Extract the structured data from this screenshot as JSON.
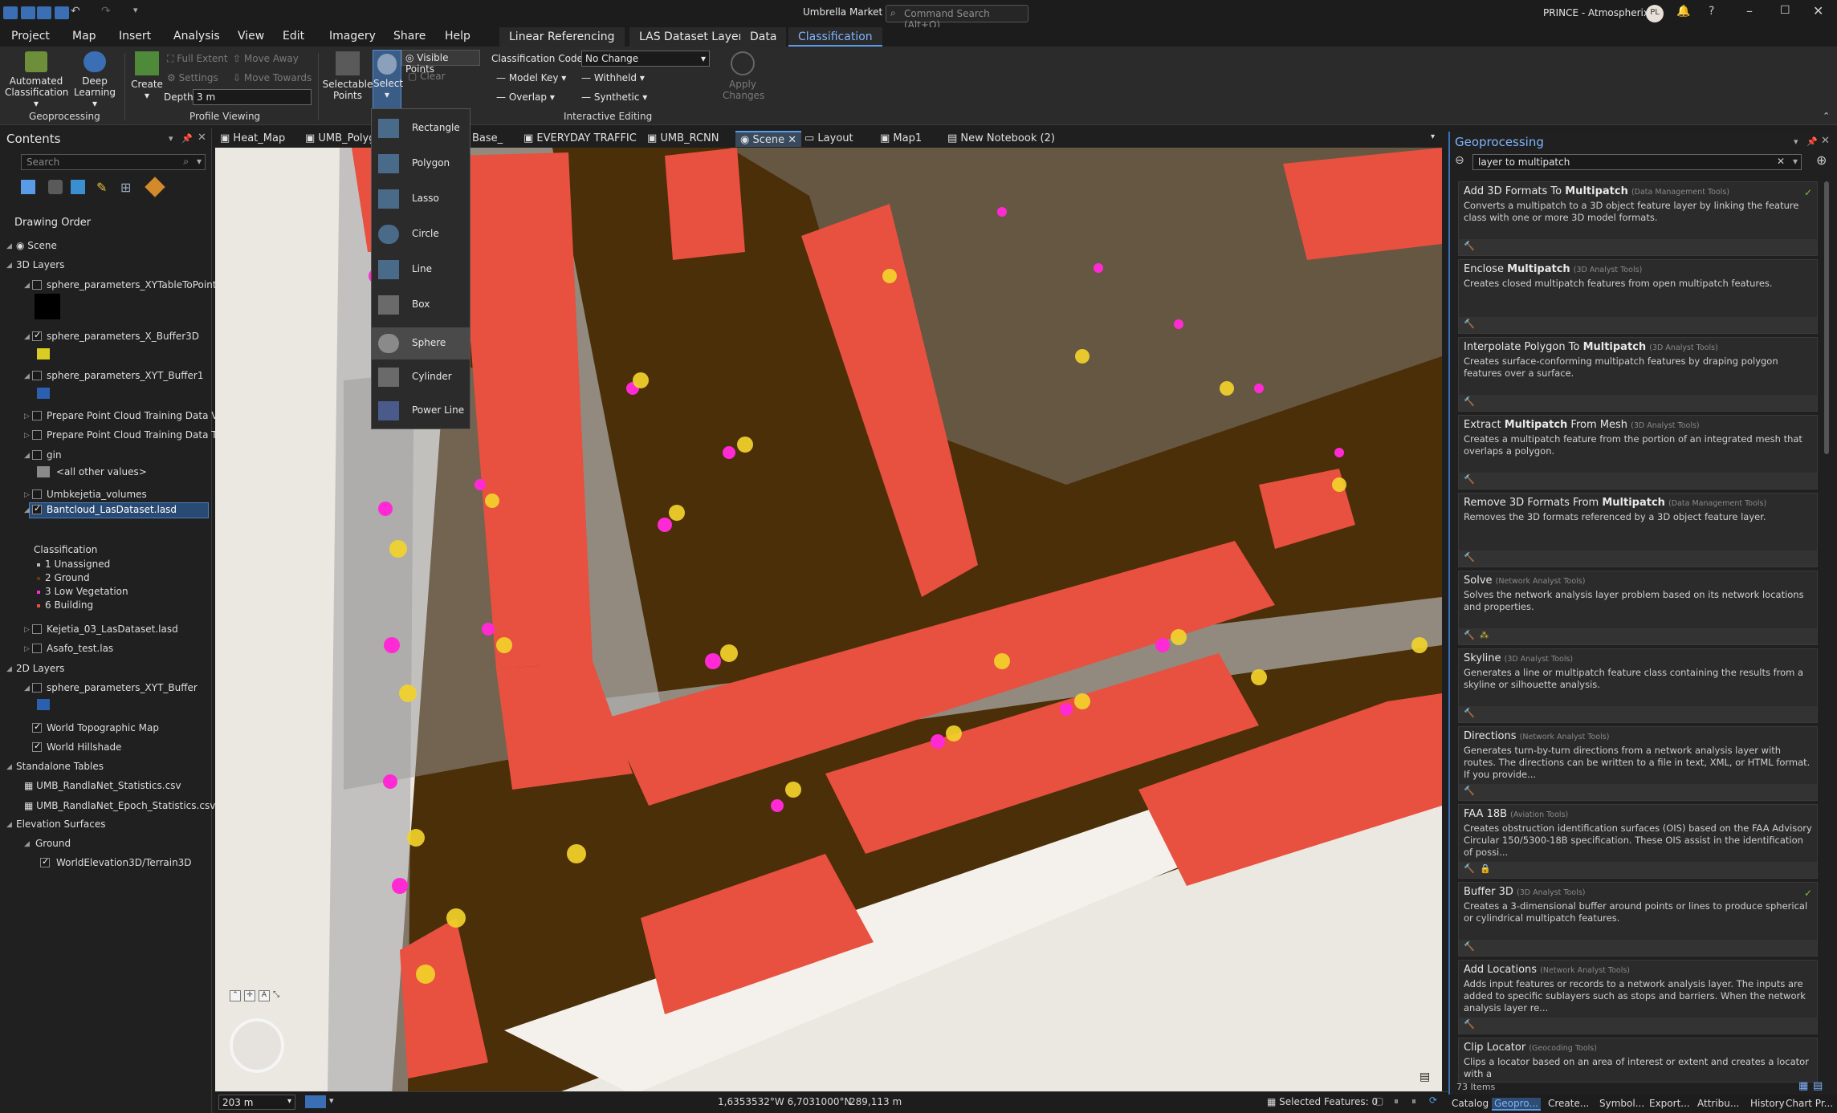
{
  "title_bar": {
    "project_name": "Umbrella Market",
    "search_placeholder": "Command Search (Alt+Q)",
    "user": "PRINCE - Atmospherix",
    "user_initials": "PL"
  },
  "ribbon_tabs": [
    "Project",
    "Map",
    "Insert",
    "Analysis",
    "View",
    "Edit",
    "Imagery",
    "Share",
    "Help"
  ],
  "context_tabs": [
    "Linear Referencing",
    "LAS Dataset Layer",
    "Data",
    "Classification"
  ],
  "ribbon": {
    "automated_classification": "Automated Classification",
    "deep_learning": "Deep Learning",
    "group_geoprocessing": "Geoprocessing",
    "create": "Create",
    "full_extent": "Full Extent",
    "move_away": "Move Away",
    "settings": "Settings",
    "move_towards": "Move Towards",
    "depth_label": "Depth",
    "depth_value": "3 m",
    "group_profile_viewing": "Profile Viewing",
    "selectable_points": "Selectable Points",
    "select": "Select",
    "visible_points": "Visible Points",
    "clear": "Clear",
    "classification_code_label": "Classification Code",
    "classification_code_value": "No Change",
    "model_key": "Model Key",
    "withheld": "Withheld",
    "overlap": "Overlap",
    "synthetic": "Synthetic",
    "apply_changes": "Apply Changes",
    "group_interactive_editing": "Interactive Editing"
  },
  "select_menu": [
    "Rectangle",
    "Polygon",
    "Lasso",
    "Circle",
    "Line",
    "Box",
    "Sphere",
    "Cylinder",
    "Power Line"
  ],
  "view_tabs": [
    "Heat_Map",
    "UMB_Polyg",
    "Base_",
    "EVERYDAY TRAFFIC",
    "UMB_RCNN",
    "Scene",
    "Layout",
    "Map1",
    "New Notebook (2)"
  ],
  "contents": {
    "title": "Contents",
    "search_placeholder": "Search",
    "drawing_order": "Drawing Order",
    "scene": "Scene",
    "layers_3d": "3D Layers",
    "l1": "sphere_parameters_XYTableToPoint",
    "l2": "sphere_parameters_X_Buffer3D",
    "l3": "sphere_parameters_XYT_Buffer1",
    "l4": "Prepare Point Cloud Training Data V...",
    "l5": "Prepare Point Cloud Training Data T...",
    "l6": "gin",
    "l6_sub": "<all other values>",
    "l7": "Umbkejetia_volumes",
    "l8": "Bantcloud_LasDataset.lasd",
    "classification": "Classification",
    "classes": [
      "1  Unassigned",
      "2  Ground",
      "3  Low Vegetation",
      "6  Building"
    ],
    "l9": "Kejetia_03_LasDataset.lasd",
    "l10": "Asafo_test.las",
    "layers_2d": "2D Layers",
    "l11": "sphere_parameters_XYT_Buffer",
    "l12": "World Topographic Map",
    "l13": "World Hillshade",
    "standalone": "Standalone Tables",
    "t1": "UMB_RandlaNet_Statistics.csv",
    "t2": "UMB_RandlaNet_Epoch_Statistics.csv",
    "elevation": "Elevation Surfaces",
    "ground": "Ground",
    "terrain": "WorldElevation3D/Terrain3D"
  },
  "geoprocessing": {
    "title": "Geoprocessing",
    "search_value": "layer to multipatch",
    "items_count": "73 Items",
    "results": [
      {
        "pre": "Add 3D Formats To ",
        "bold": "Multipatch",
        "toolbox": "(Data Management Tools)",
        "desc": "Converts a multipatch to a 3D object feature layer by linking the feature class with one or more 3D model formats."
      },
      {
        "pre": "Enclose ",
        "bold": "Multipatch",
        "toolbox": "(3D Analyst Tools)",
        "desc": "Creates  closed multipatch features from open multipatch features."
      },
      {
        "pre": "Interpolate Polygon To ",
        "bold": "Multipatch",
        "toolbox": "(3D Analyst Tools)",
        "desc": "Creates surface-conforming  multipatch features by draping polygon features over a surface."
      },
      {
        "pre": "Extract ",
        "bold": "Multipatch",
        "post": " From Mesh",
        "toolbox": "(3D Analyst Tools)",
        "desc": "Creates a multipatch feature from the portion of an integrated mesh that overlaps a polygon."
      },
      {
        "pre": "Remove 3D Formats From ",
        "bold": "Multipatch",
        "toolbox": "(Data Management Tools)",
        "desc": "Removes the 3D formats  referenced by a 3D object feature layer."
      },
      {
        "pre": "Solve",
        "toolbox": "(Network Analyst Tools)",
        "desc": "Solves the network analysis layer problem based on its network locations and properties."
      },
      {
        "pre": "Skyline",
        "toolbox": "(3D Analyst Tools)",
        "desc": "Generates a line or multipatch feature class containing the results from a skyline or silhouette analysis."
      },
      {
        "pre": "Directions",
        "toolbox": "(Network Analyst Tools)",
        "desc": "Generates turn-by-turn directions from a network analysis layer with routes. The directions can be written to a file in text, XML, or HTML format. If you provide..."
      },
      {
        "pre": "FAA 18B",
        "toolbox": "(Aviation Tools)",
        "desc": "Creates obstruction identification surfaces (OIS) based on the FAA Advisory Circular 150/5300-18B specification. These OIS assist in the identification of possi..."
      },
      {
        "pre": "Buffer 3D",
        "toolbox": "(3D Analyst Tools)",
        "desc": "Creates a 3-dimensional buffer around points or lines to produce spherical or cylindrical multipatch features."
      },
      {
        "pre": "Add Locations",
        "toolbox": "(Network Analyst Tools)",
        "desc": "Adds input features or records to a network analysis layer. The inputs are added to specific sublayers such as stops and barriers. When the network analysis layer re..."
      },
      {
        "pre": "Clip Locator",
        "toolbox": "(Geocoding Tools)",
        "desc": "Clips a locator based on an area of interest or extent  and creates a locator with a"
      }
    ]
  },
  "status": {
    "scale": "203 m",
    "coords": "1,6353532°W 6,7031000°N",
    "elevation": "289,113 m",
    "selected": "Selected Features: 0"
  },
  "bottom_tabs": [
    "Catalog",
    "Geopro...",
    "Create...",
    "Symbol...",
    "Export...",
    "Attribu...",
    "History",
    "Chart Pr..."
  ]
}
